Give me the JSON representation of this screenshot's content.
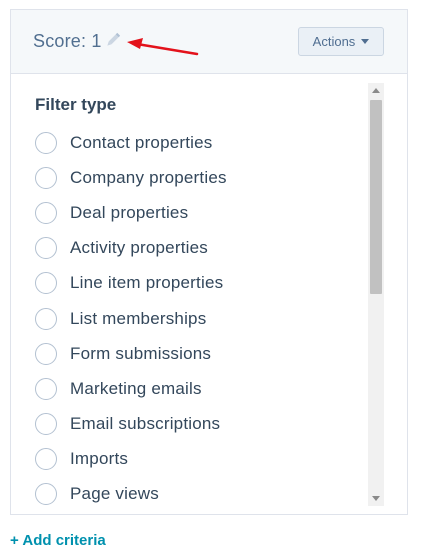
{
  "header": {
    "score_label": "Score: 1",
    "actions_label": "Actions",
    "colors": {
      "annotation_arrow": "#e3121b",
      "header_bg": "#f5f8fa"
    }
  },
  "panel": {
    "title": "Filter type",
    "items": [
      "Contact properties",
      "Company properties",
      "Deal properties",
      "Activity properties",
      "Line item properties",
      "List memberships",
      "Form submissions",
      "Marketing emails",
      "Email subscriptions",
      "Imports",
      "Page views"
    ]
  },
  "footer": {
    "add_criteria_label": "+ Add criteria",
    "link_color": "#0091ae"
  },
  "icons": {
    "edit": "pencil-icon",
    "dropdown": "caret-down-icon",
    "annotation": "red-arrow-icon"
  }
}
